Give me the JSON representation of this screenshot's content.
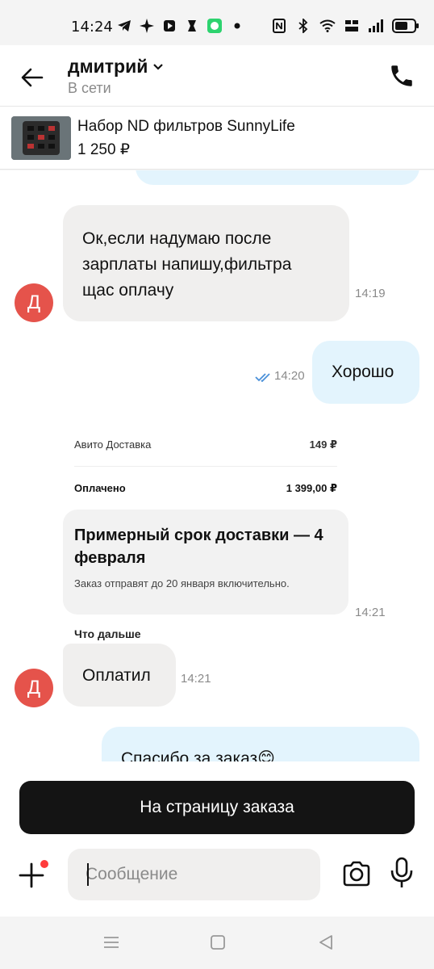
{
  "status_bar": {
    "time": "14:24",
    "icons": [
      "telegram-icon",
      "sparkle-icon",
      "app-icon",
      "app-icon-2",
      "wechat-icon",
      "dot-icon",
      "nfc-icon",
      "bluetooth-icon",
      "wifi-icon",
      "volte-icon",
      "signal-icon",
      "battery-icon"
    ]
  },
  "header": {
    "name": "дмитрий",
    "status": "В сети"
  },
  "product": {
    "title": "Набор ND фильтров SunnyLife",
    "price": "1 250 ₽"
  },
  "messages": [
    {
      "direction": "in",
      "text_lines": [
        "Ок,если надумаю после",
        "зарплаты напишу,фильтра",
        "щас оплачу"
      ],
      "time": "14:19",
      "avatar": "Д"
    },
    {
      "direction": "out",
      "text": "Хорошо",
      "time": "14:20",
      "read": true
    },
    {
      "direction": "in",
      "type": "image",
      "time": "14:21",
      "image": {
        "row1_label": "Авито Доставка",
        "row1_value": "149 ₽",
        "row2_label": "Оплачено",
        "row2_value": "1 399,00 ₽",
        "heading": "Примерный срок доставки — 4 февраля",
        "sub": "Заказ отправят до 20 января включительно.",
        "next": "Что дальше"
      }
    },
    {
      "direction": "in",
      "text": "Оплатил",
      "time": "14:21",
      "avatar": "Д"
    },
    {
      "direction": "out",
      "text": "Спасибо за заказ😊"
    }
  ],
  "order_button": {
    "label": "На страницу заказа"
  },
  "input": {
    "placeholder": "Сообщение"
  },
  "colors": {
    "avatar": "#e5534b",
    "incoming_bubble": "#f0efee",
    "outgoing_bubble": "#e3f4fd",
    "button": "#141414",
    "badge": "#ff3b3b",
    "check": "#4a90d9"
  }
}
